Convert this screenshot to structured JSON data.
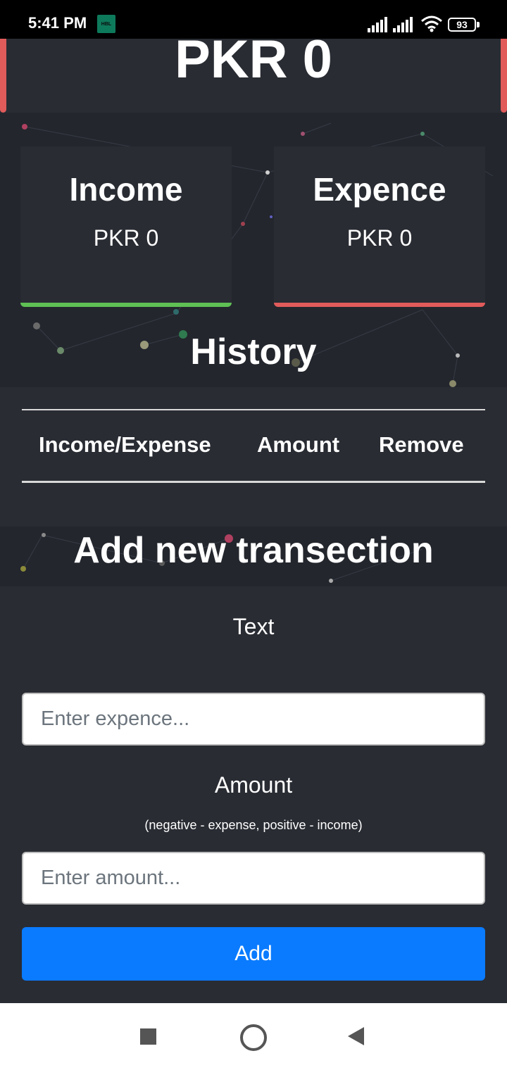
{
  "status_bar": {
    "time": "5:41 PM",
    "app_badge": "HBL",
    "battery": "93"
  },
  "balance": {
    "value": "PKR 0"
  },
  "income_card": {
    "title": "Income",
    "value": "PKR 0",
    "accent": "#5fbf54"
  },
  "expense_card": {
    "title": "Expence",
    "value": "PKR 0",
    "accent": "#e15b5b"
  },
  "history": {
    "title": "History",
    "columns": [
      "Income/Expense",
      "Amount",
      "Remove"
    ]
  },
  "add_form": {
    "title": "Add new transection",
    "text_label": "Text",
    "text_placeholder": "Enter expence...",
    "amount_label": "Amount",
    "amount_hint": "(negative - expense, positive - income)",
    "amount_placeholder": "Enter amount...",
    "submit_label": "Add",
    "submit_color": "#0a7bff"
  },
  "nav": {
    "icons": [
      "recent-apps-icon",
      "home-icon",
      "back-icon"
    ]
  }
}
